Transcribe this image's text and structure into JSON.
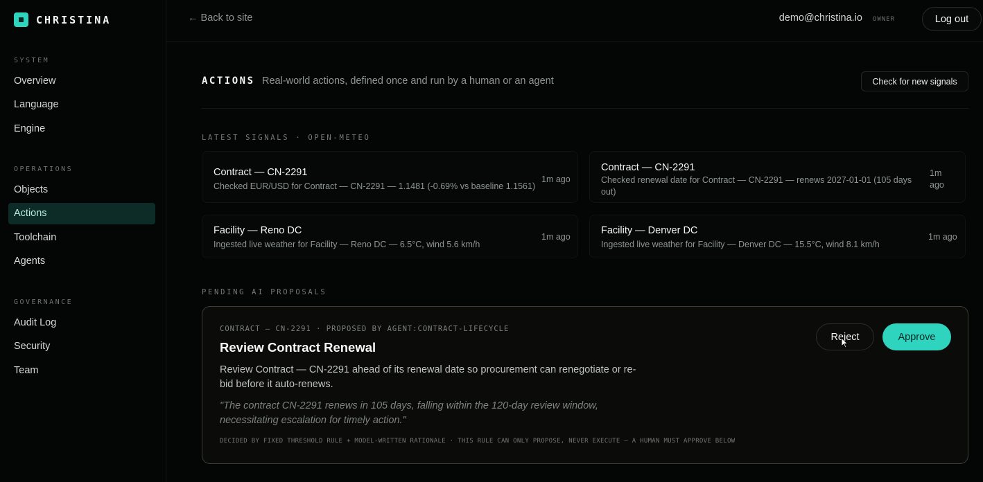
{
  "brand": {
    "name": "CHRISTINA",
    "icon": "logo-square-icon",
    "accent": "#2fd4bf"
  },
  "topbar": {
    "back_label": "← Back to site",
    "user_email": "demo@christina.io",
    "user_role": "OWNER",
    "logout_label": "Log out"
  },
  "sidebar": {
    "sections": [
      {
        "heading": "SYSTEM",
        "items": [
          {
            "label": "Overview"
          },
          {
            "label": "Language"
          },
          {
            "label": "Engine"
          }
        ]
      },
      {
        "heading": "OPERATIONS",
        "items": [
          {
            "label": "Objects"
          },
          {
            "label": "Actions",
            "active": true
          },
          {
            "label": "Toolchain"
          },
          {
            "label": "Agents"
          }
        ]
      },
      {
        "heading": "GOVERNANCE",
        "items": [
          {
            "label": "Audit Log"
          },
          {
            "label": "Security"
          },
          {
            "label": "Team"
          }
        ]
      }
    ]
  },
  "page": {
    "title": "ACTIONS",
    "subtitle": "Real-world actions, defined once and run by a human or an agent",
    "check_button": "Check for new signals"
  },
  "signals": {
    "heading": "LATEST SIGNALS · OPEN-METEO",
    "items": [
      {
        "title": "Contract — CN-2291",
        "desc": "Checked EUR/USD for Contract — CN-2291 — 1.1481 (-0.69% vs baseline 1.1561)",
        "time": "1m ago"
      },
      {
        "title": "Contract — CN-2291",
        "desc": "Checked renewal date for Contract — CN-2291 — renews 2027-01-01 (105 days out)",
        "time": "1m ago"
      },
      {
        "title": "Facility — Reno DC",
        "desc": "Ingested live weather for Facility — Reno DC — 6.5°C, wind 5.6 km/h",
        "time": "1m ago"
      },
      {
        "title": "Facility — Denver DC",
        "desc": "Ingested live weather for Facility — Denver DC — 15.5°C, wind 8.1 km/h",
        "time": "1m ago"
      }
    ]
  },
  "proposals": {
    "heading": "PENDING AI PROPOSALS",
    "item": {
      "meta": "CONTRACT — CN-2291 · PROPOSED BY AGENT:CONTRACT-LIFECYCLE",
      "title": "Review Contract Renewal",
      "body": "Review Contract — CN-2291 ahead of its renewal date so procurement can renegotiate or re-bid before it auto-renews.",
      "quote": "\"The contract CN-2291 renews in 105 days, falling within the 120-day review window, necessitating escalation for timely action.\"",
      "footer": "DECIDED BY FIXED THRESHOLD RULE + MODEL-WRITTEN RATIONALE · THIS RULE CAN ONLY PROPOSE, NEVER EXECUTE — A HUMAN MUST APPROVE BELOW",
      "reject_label": "Reject",
      "approve_label": "Approve"
    }
  }
}
